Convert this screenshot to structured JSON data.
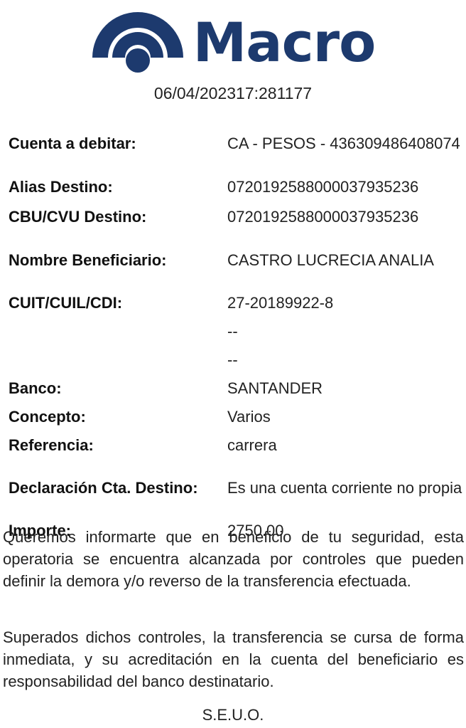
{
  "brand": {
    "name": "Macro",
    "logo_icon": "macro-arch-logo-icon",
    "color": "#1d3a6e"
  },
  "header": {
    "date": "06/04/2023",
    "time": "17:28",
    "operation_number": "1177"
  },
  "fields": [
    {
      "label": "Cuenta a debitar:",
      "value": "CA - PESOS - 436309486408074"
    },
    {
      "label": "Alias Destino:",
      "value": "0720192588000037935236"
    },
    {
      "label": "CBU/CVU Destino:",
      "value": "0720192588000037935236"
    },
    {
      "label": "Nombre Beneficiario:",
      "value": "CASTRO LUCRECIA ANALIA"
    },
    {
      "label": "CUIT/CUIL/CDI:",
      "value": "27-20189922-8"
    },
    {
      "label": "",
      "value": "--"
    },
    {
      "label": "",
      "value": "--"
    },
    {
      "label": "Banco:",
      "value": "SANTANDER"
    },
    {
      "label": "Concepto:",
      "value": "Varios"
    },
    {
      "label": "Referencia:",
      "value": "carrera"
    },
    {
      "label": "Declaración Cta. Destino:",
      "value": "Es una cuenta corriente no propia"
    },
    {
      "label": "Importe:",
      "value": "2750.00"
    }
  ],
  "notices": [
    "Queremos informarte que en beneficio de tu seguridad, esta operatoria se encuentra alcanzada por controles que pueden definir la demora y/o reverso de la transferencia efectuada.",
    "Superados dichos controles, la transferencia se cursa de forma inmediata, y su acreditación en la cuenta del beneficiario es responsabilidad del banco destinatario."
  ],
  "footer": {
    "seuo": "S.E.U.O."
  }
}
